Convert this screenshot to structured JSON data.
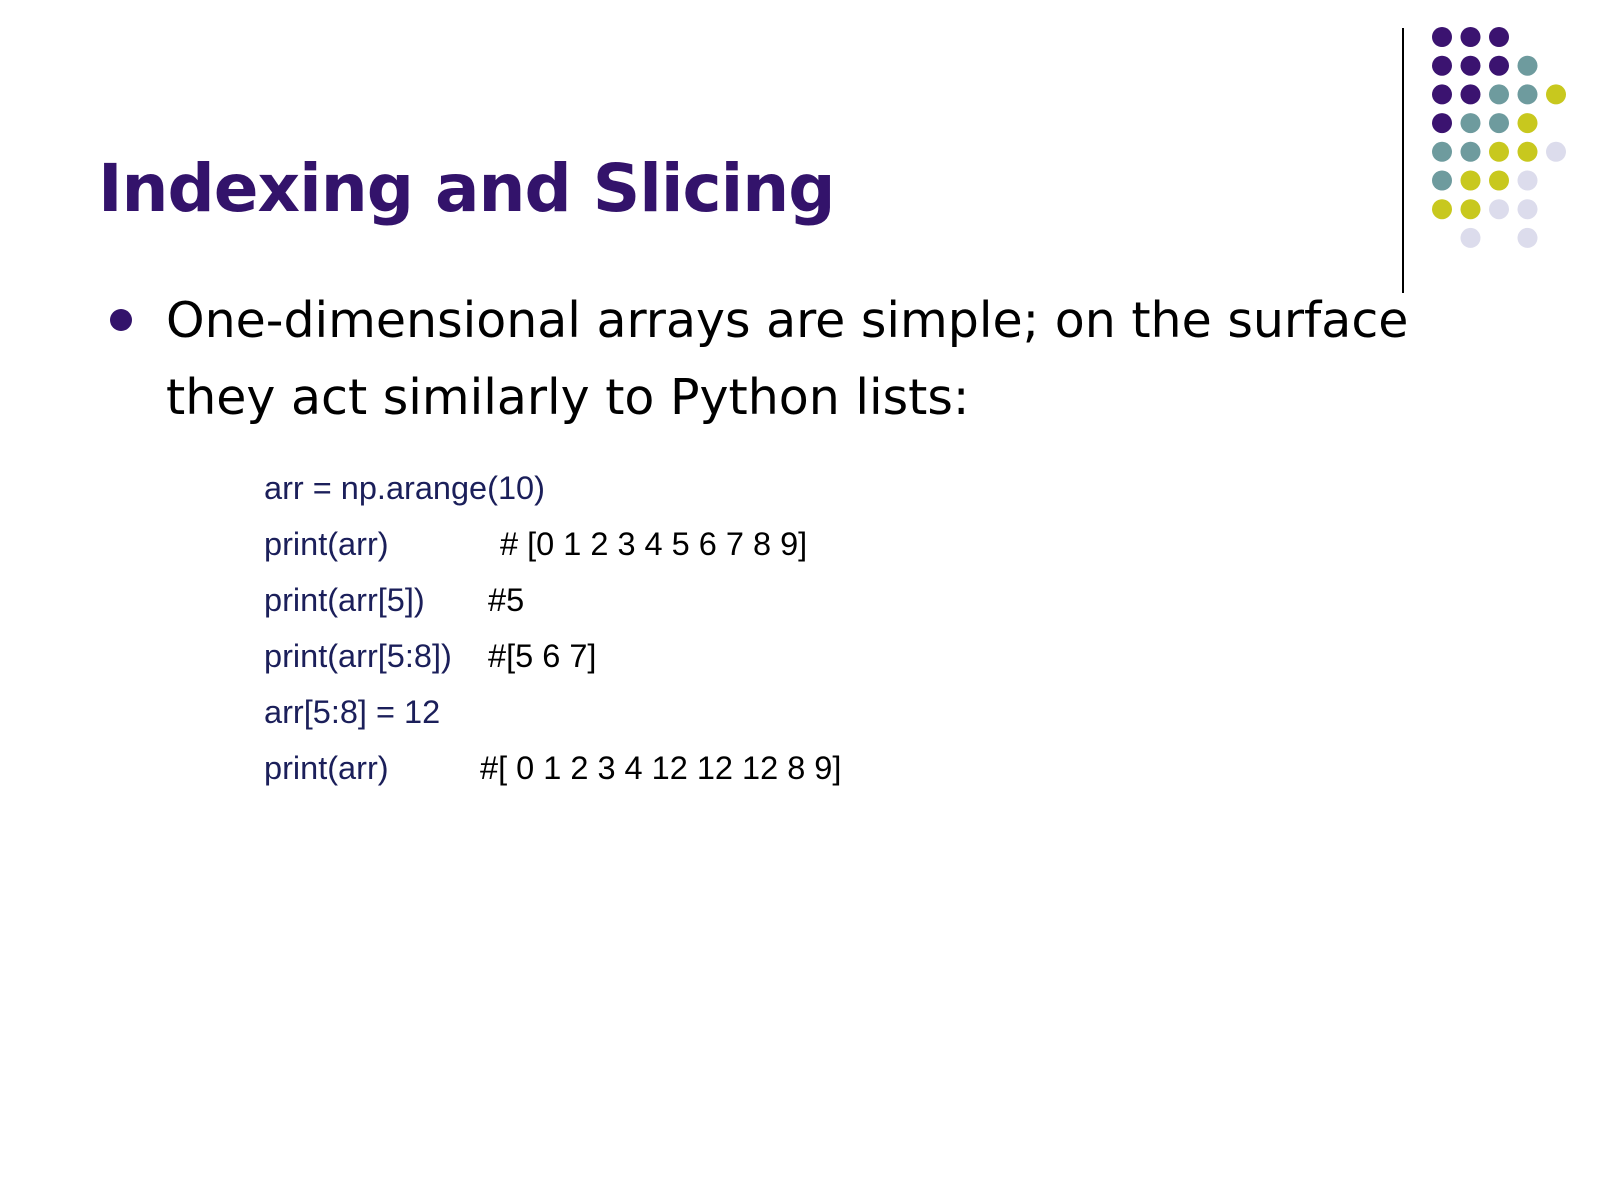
{
  "slide": {
    "title": "Indexing and Slicing",
    "bullet": "One-dimensional arrays are simple; on the surface they act similarly to Python lists:",
    "code_lines": [
      {
        "code": "arr = np.arange(10)",
        "comment": ""
      },
      {
        "code": "print(arr)",
        "comment": "# [0 1 2 3 4 5 6 7 8 9]"
      },
      {
        "code": "print(arr[5])",
        "comment": "#5"
      },
      {
        "code": "print(arr[5:8])",
        "comment": "#[5 6 7]"
      },
      {
        "code": "arr[5:8] = 12",
        "comment": ""
      },
      {
        "code": "print(arr)",
        "comment": "#[ 0 1 2 3 4 12 12 12 8 9]"
      }
    ]
  },
  "theme": {
    "title_color": "#33136b",
    "code_color": "#1b1f5a",
    "dot_colors": {
      "purple": "#3b1370",
      "teal": "#6e9b9e",
      "yellow": "#c8c81e",
      "lavender": "#dcdcec"
    }
  }
}
